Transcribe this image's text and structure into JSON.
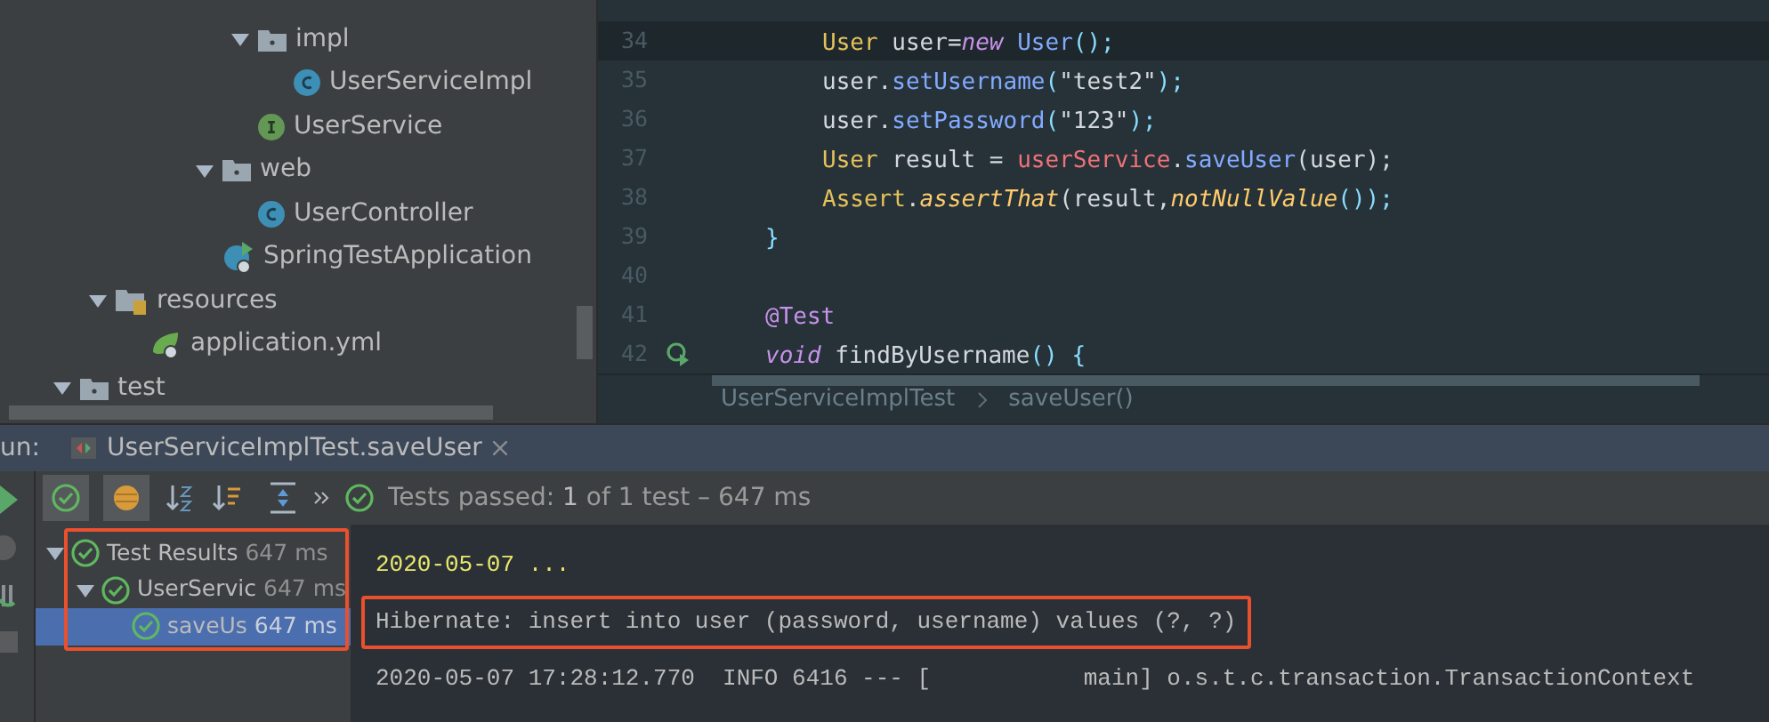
{
  "project_tree": {
    "items": [
      {
        "label": "impl",
        "kind": "folder",
        "expanded": true,
        "children": [
          {
            "label": "UserServiceImpl",
            "kind": "class"
          }
        ]
      },
      {
        "label": "UserService",
        "kind": "interface"
      },
      {
        "label": "web",
        "kind": "folder",
        "expanded": true,
        "children": [
          {
            "label": "UserController",
            "kind": "class"
          }
        ]
      },
      {
        "label": "SpringTestApplication",
        "kind": "app"
      },
      {
        "label": "resources",
        "kind": "resources",
        "expanded": true,
        "children": [
          {
            "label": "application.yml",
            "kind": "yml"
          }
        ]
      },
      {
        "label": "test",
        "kind": "folder",
        "expanded": true
      }
    ]
  },
  "editor": {
    "lines": [
      {
        "number": "34",
        "current": true,
        "kind": "body",
        "tokens": [
          {
            "text": "User",
            "kind": "type"
          },
          {
            "text": " user=",
            "kind": "plain"
          },
          {
            "text": "new",
            "kind": "keyword"
          },
          {
            "text": " User",
            "kind": "method"
          },
          {
            "text": "();",
            "kind": "punct"
          }
        ]
      },
      {
        "number": "35",
        "current": false,
        "kind": "body",
        "tokens": [
          {
            "text": "user.",
            "kind": "plain"
          },
          {
            "text": "setUsername",
            "kind": "method"
          },
          {
            "text": "(",
            "kind": "punct"
          },
          {
            "text": "\"test2\"",
            "kind": "plain"
          },
          {
            "text": ");",
            "kind": "punct"
          }
        ]
      },
      {
        "number": "36",
        "current": false,
        "kind": "body",
        "tokens": [
          {
            "text": "user.",
            "kind": "plain"
          },
          {
            "text": "setPassword",
            "kind": "method"
          },
          {
            "text": "(",
            "kind": "punct"
          },
          {
            "text": "\"123\"",
            "kind": "plain"
          },
          {
            "text": ");",
            "kind": "punct"
          }
        ]
      },
      {
        "number": "37",
        "current": false,
        "kind": "body",
        "tokens": [
          {
            "text": "User",
            "kind": "type"
          },
          {
            "text": " result = ",
            "kind": "plain"
          },
          {
            "text": "userService",
            "kind": "field"
          },
          {
            "text": ".",
            "kind": "plain"
          },
          {
            "text": "saveUser",
            "kind": "method"
          },
          {
            "text": "(user);",
            "kind": "plain"
          }
        ]
      },
      {
        "number": "38",
        "current": false,
        "kind": "body",
        "tokens": [
          {
            "text": "Assert",
            "kind": "type"
          },
          {
            "text": ".",
            "kind": "plain"
          },
          {
            "text": "assertThat",
            "kind": "static"
          },
          {
            "text": "(result,",
            "kind": "plain"
          },
          {
            "text": "notNullValue",
            "kind": "static"
          },
          {
            "text": "());",
            "kind": "punct"
          }
        ]
      },
      {
        "number": "39",
        "current": false,
        "kind": "member",
        "tokens": [
          {
            "text": "}",
            "kind": "punct"
          }
        ]
      },
      {
        "number": "40",
        "current": false
      },
      {
        "number": "41",
        "current": false,
        "kind": "member",
        "tokens": [
          {
            "text": "@Test",
            "kind": "annotation"
          }
        ]
      },
      {
        "number": "42",
        "current": false,
        "kind": "member",
        "run_marker": true,
        "tokens": [
          {
            "text": "void",
            "kind": "keyword"
          },
          {
            "text": " findByUsername",
            "kind": "plain"
          },
          {
            "text": "() {",
            "kind": "punct"
          }
        ]
      }
    ],
    "breadcrumbs": [
      "UserServiceImplTest",
      "saveUser()"
    ]
  },
  "run_panel": {
    "label": "un:",
    "tab": {
      "title": "UserServiceImplTest.saveUser",
      "selected": true
    },
    "status": {
      "prefix": "Tests passed:",
      "count": "1",
      "rest": "of 1 test – 647 ms"
    },
    "results": [
      {
        "label": "Test Results",
        "time": "647 ms",
        "selected": false,
        "children": [
          {
            "label": "UserServic",
            "time": "647 ms",
            "selected": false,
            "children": [
              {
                "label": "saveUs",
                "time": "647 ms",
                "selected": true
              }
            ]
          }
        ]
      }
    ],
    "console": [
      {
        "text": "2020-05-07 ...",
        "kind": "highlight",
        "boxed": false
      },
      {
        "text": "Hibernate: insert into user (password, username) values (?, ?)",
        "kind": "plain",
        "boxed": true
      },
      {
        "text": "2020-05-07 17:28:12.770  INFO 6416 --- [           main] o.s.t.c.transaction.TransactionContext",
        "kind": "plain",
        "boxed": false
      }
    ]
  }
}
